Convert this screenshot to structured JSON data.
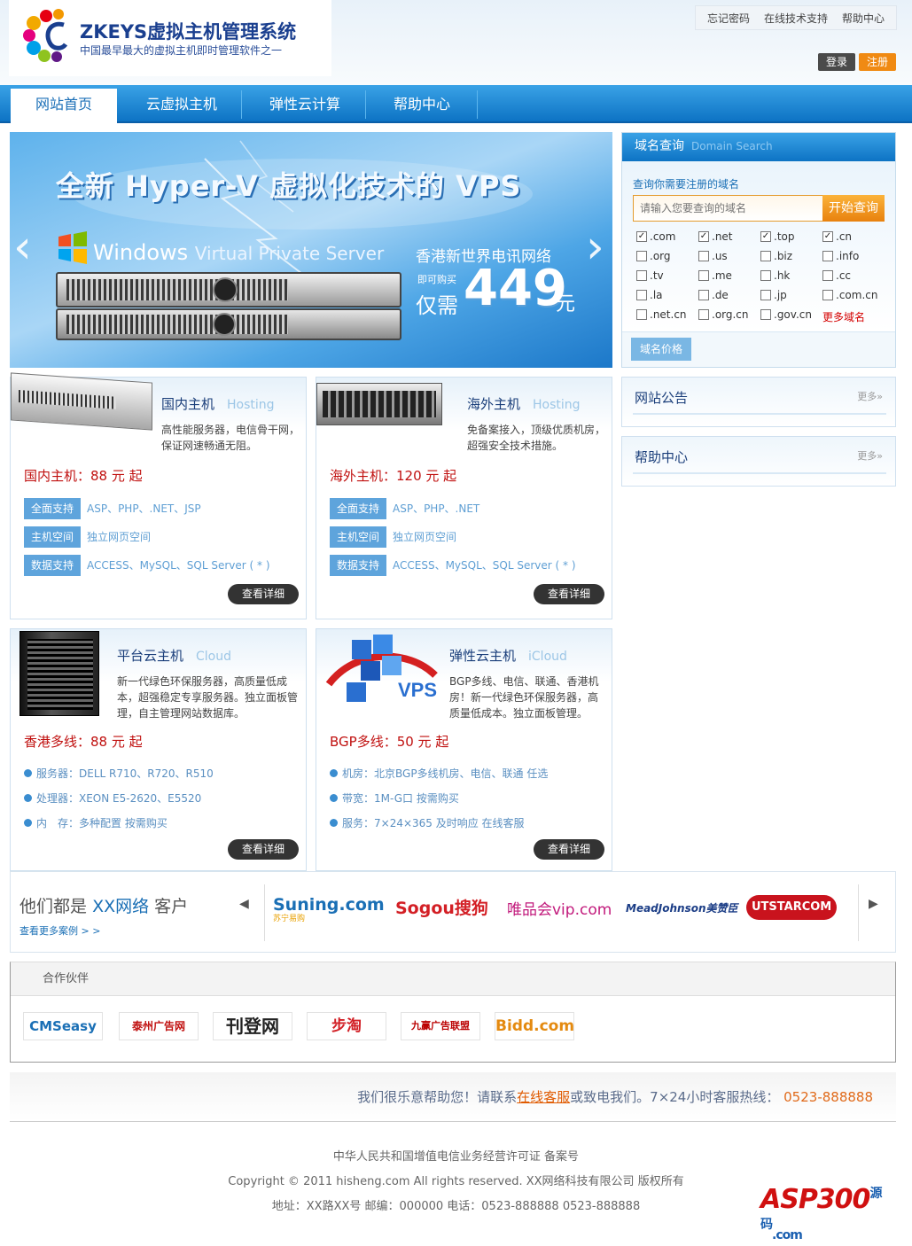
{
  "header": {
    "logo_title": "ZKEYS虚拟主机管理系统",
    "logo_slogan": "中国最早最大的虚拟主机即时管理软件之一",
    "top_links": [
      "忘记密码",
      "在线技术支持",
      "帮助中心"
    ],
    "login_label": "登录",
    "register_label": "注册"
  },
  "nav": {
    "items": [
      {
        "label": "网站首页",
        "active": true
      },
      {
        "label": "云虚拟主机",
        "active": false
      },
      {
        "label": "弹性云计算",
        "active": false
      },
      {
        "label": "帮助中心",
        "active": false
      }
    ]
  },
  "banner": {
    "headline": "全新 Hyper-V 虚拟化技术的 VPS",
    "windows_text": "Windows",
    "windows_sub": "Virtual Private Server",
    "network": "香港新世界电讯网络",
    "buy_now": "即可购买",
    "only": "仅需",
    "price": "449",
    "unit": "元",
    "prev": "‹",
    "next": "›"
  },
  "domain_search": {
    "title": "域名查询",
    "subtitle": "Domain Search",
    "prompt": "查询你需要注册的域名",
    "placeholder": "请输入您要查询的域名",
    "search_button": "开始查询",
    "tlds": [
      {
        "name": ".com",
        "checked": true
      },
      {
        "name": ".net",
        "checked": true
      },
      {
        "name": ".top",
        "checked": true
      },
      {
        "name": ".cn",
        "checked": true
      },
      {
        "name": ".org",
        "checked": false
      },
      {
        "name": ".us",
        "checked": false
      },
      {
        "name": ".biz",
        "checked": false
      },
      {
        "name": ".info",
        "checked": false
      },
      {
        "name": ".tv",
        "checked": false
      },
      {
        "name": ".me",
        "checked": false
      },
      {
        "name": ".hk",
        "checked": false
      },
      {
        "name": ".cc",
        "checked": false
      },
      {
        "name": ".la",
        "checked": false
      },
      {
        "name": ".de",
        "checked": false
      },
      {
        "name": ".jp",
        "checked": false
      },
      {
        "name": ".com.cn",
        "checked": false
      },
      {
        "name": ".net.cn",
        "checked": false
      },
      {
        "name": ".org.cn",
        "checked": false
      },
      {
        "name": ".gov.cn",
        "checked": false
      }
    ],
    "more_domains": "更多域名",
    "price_button": "域名价格"
  },
  "products": [
    {
      "title": "国内主机",
      "title_en": "Hosting",
      "desc": [
        "高性能服务器，电信骨干网，",
        "保证网速畅通无阻。"
      ],
      "price": "国内主机：88 元 起",
      "specs": [
        {
          "tag": "全面支持",
          "value": "ASP、PHP、.NET、JSP"
        },
        {
          "tag": "主机空间",
          "value": "独立网页空间"
        },
        {
          "tag": "数据支持",
          "value": "ACCESS、MySQL、SQL Server ( * )"
        }
      ],
      "button": "查看详细"
    },
    {
      "title": "海外主机",
      "title_en": "Hosting",
      "desc": [
        "免备案接入，顶级优质机房，",
        "超强安全技术措施。"
      ],
      "price": "海外主机：120 元 起",
      "specs": [
        {
          "tag": "全面支持",
          "value": "ASP、PHP、.NET"
        },
        {
          "tag": "主机空间",
          "value": "独立网页空间"
        },
        {
          "tag": "数据支持",
          "value": "ACCESS、MySQL、SQL Server ( * )"
        }
      ],
      "button": "查看详细"
    },
    {
      "title": "平台云主机",
      "title_en": "Cloud",
      "desc": [
        "新一代绿色环保服务器，高质量低成",
        "本，超强稳定专享服务器。独立面板管",
        "理，自主管理网站数据库。"
      ],
      "price": "香港多线：88 元 起",
      "bullets": [
        "服务器：DELL R710、R720、R510",
        "处理器：XEON E5-2620、E5520",
        "内　存：多种配置 按需购买"
      ],
      "button": "查看详细"
    },
    {
      "title": "弹性云主机",
      "title_en": "iCloud",
      "desc": [
        "BGP多线、电信、联通、香港机",
        "房！新一代绿色环保服务器，高",
        "质量低成本。独立面板管理。"
      ],
      "price": "BGP多线：50 元 起",
      "bullets": [
        "机房：北京BGP多线机房、电信、联通 任选",
        "带宽：1M-G口 按需购买",
        "服务：7×24×365 及时响应 在线客服"
      ],
      "button": "查看详细",
      "image_text": "VPS"
    }
  ],
  "side_boxes": [
    {
      "title": "网站公告",
      "more": "更多»"
    },
    {
      "title": "帮助中心",
      "more": "更多»"
    }
  ],
  "clients": {
    "heading_pre": "他们都是",
    "heading_brand": "XX网络",
    "heading_post": "客户",
    "more_link": "查看更多案例 > >",
    "logos": [
      "Suning.com",
      "苏宁易购",
      "Sogou搜狗",
      "唯品会vip.com",
      "MeadJohnson美赞臣",
      "UTSTARCOM"
    ]
  },
  "partners": {
    "title": "合作伙伴",
    "logos": [
      "CMSeasy",
      "泰州广告网",
      "刊登网",
      "步淘",
      "九赢广告联盟",
      "Bidd.com"
    ]
  },
  "help_bar": {
    "text_pre": "我们很乐意帮助您！请联系",
    "link": "在线客服",
    "text_mid": "或致电我们。7×24小时客服热线：",
    "phone": "0523-888888"
  },
  "footer": {
    "line1": "中华人民共和国增值电信业务经营许可证 备案号",
    "line2": "Copyright © 2011 hisheng.com All rights reserved. XX网络科技有限公司 版权所有",
    "line3": "地址：XX路XX号 邮编：000000 电话：0523-888888  0523-888888",
    "watermark": "ASP300",
    "watermark_cn": "源码",
    "watermark_dom": ".com"
  },
  "colors": {
    "nav": "#1683d3",
    "price_red": "#c0100f",
    "accent_orange": "#f08a13",
    "tag_blue": "#5ea4dc"
  }
}
